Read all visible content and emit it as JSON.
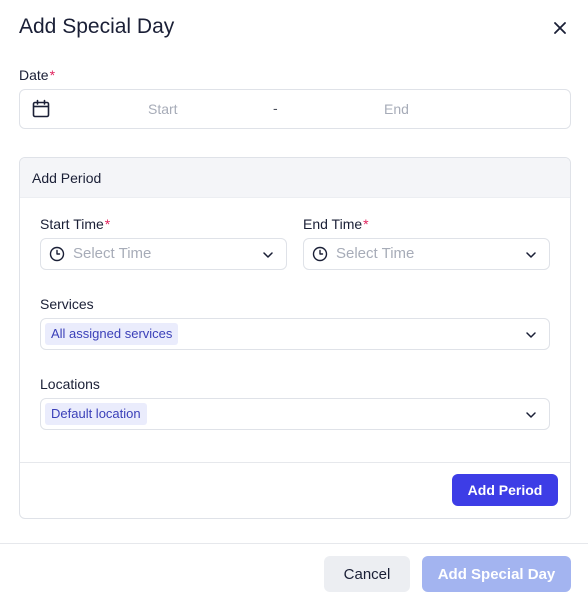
{
  "dialog": {
    "title": "Add Special Day"
  },
  "date": {
    "label": "Date",
    "required_mark": "*",
    "start_placeholder": "Start",
    "separator": "-",
    "end_placeholder": "End"
  },
  "period": {
    "header": "Add Period",
    "start_time": {
      "label": "Start Time",
      "required_mark": "*",
      "placeholder": "Select Time"
    },
    "end_time": {
      "label": "End Time",
      "required_mark": "*",
      "placeholder": "Select Time"
    },
    "services": {
      "label": "Services",
      "selected": "All assigned services"
    },
    "locations": {
      "label": "Locations",
      "selected": "Default location"
    },
    "add_button": "Add Period"
  },
  "footer": {
    "cancel_label": "Cancel",
    "submit_label": "Add Special Day"
  },
  "colors": {
    "primary": "#3d3de6",
    "primary_disabled": "#a3b4f0",
    "required": "#e0245e",
    "tag_bg": "#eaecfc",
    "tag_text": "#3a3fb8"
  },
  "icons": {
    "close": "close-icon",
    "calendar": "calendar-icon",
    "clock": "clock-icon",
    "chevron": "chevron-down-icon"
  }
}
